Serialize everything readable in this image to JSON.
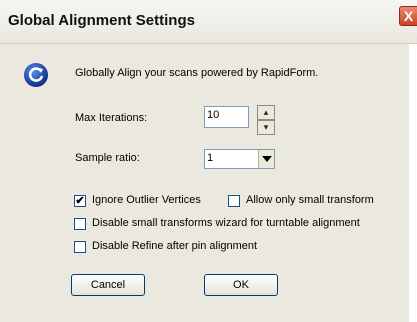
{
  "window": {
    "title": "Global Alignment Settings",
    "close_glyph": "X"
  },
  "header": {
    "icon": "refresh-circle-icon",
    "description": "Globally Align your scans powered by RapidForm."
  },
  "max_iterations": {
    "label": "Max Iterations:",
    "value": "10"
  },
  "sample_ratio": {
    "label": "Sample ratio:",
    "value": "1"
  },
  "options": {
    "ignore_outliers": {
      "label": "Ignore Outlier Vertices",
      "checked": true
    },
    "small_transform": {
      "label": "Allow only small transform",
      "checked": false
    },
    "disable_wizard": {
      "label": "Disable small transforms wizard for turntable alignment",
      "checked": false
    },
    "disable_refine": {
      "label": "Disable Refine after pin alignment",
      "checked": false
    }
  },
  "buttons": {
    "cancel": "Cancel",
    "ok": "OK"
  },
  "colors": {
    "client_bg": "#ebe9df",
    "icon_blue": "#1b4fb6",
    "close_red": "#c8452a"
  }
}
